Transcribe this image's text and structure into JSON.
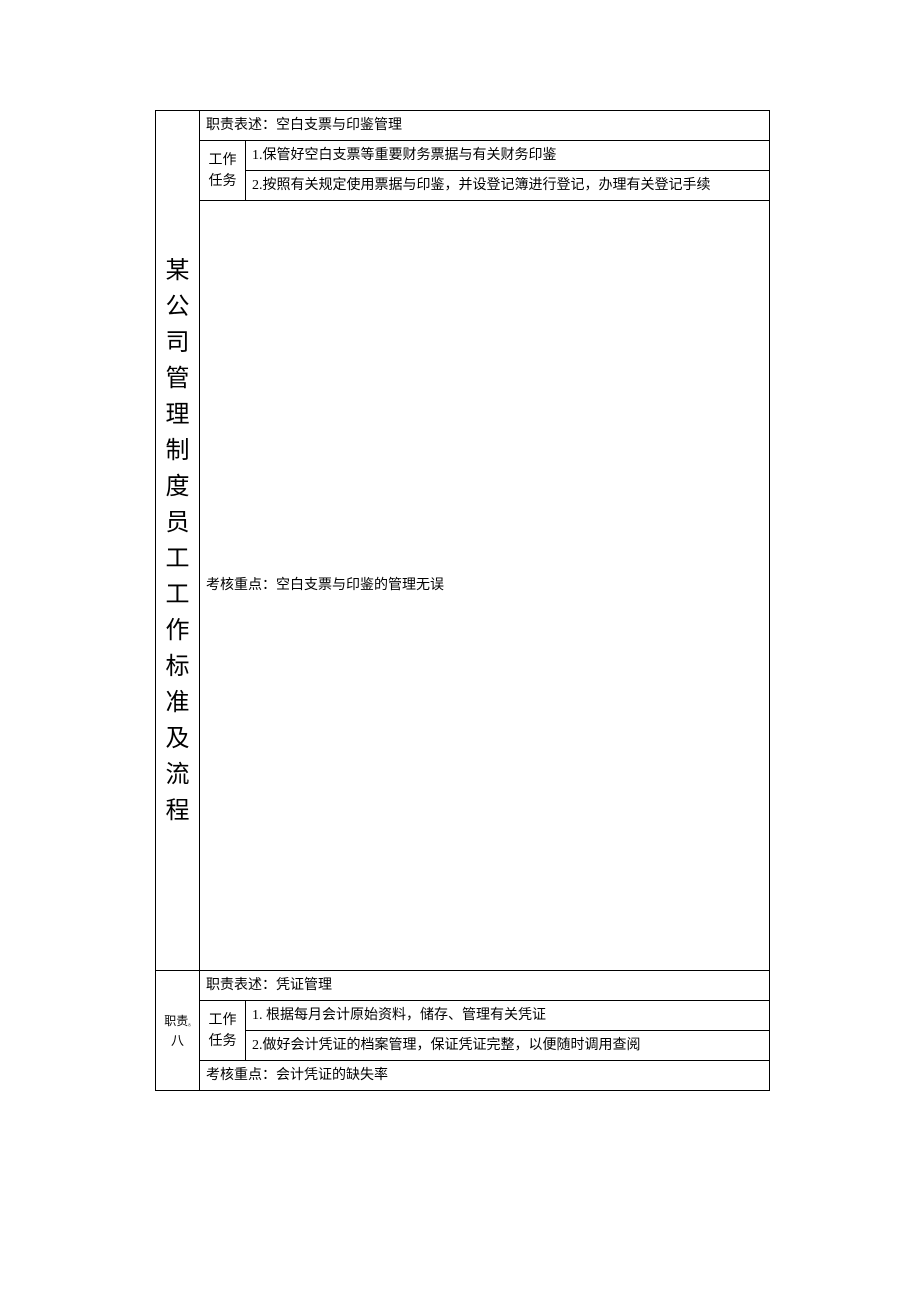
{
  "verticalTitle": "某公司管理制度员工工作标准及流程",
  "section1": {
    "dutyDescription": "职责表述：空白支票与印鉴管理",
    "taskLabel": "工作任务",
    "task1": "1.保管好空白支票等重要财务票据与有关财务印鉴",
    "task2": "2.按照有关规定使用票据与印鉴，并设登记簿进行登记，办理有关登记手续",
    "assessment": "考核重点：空白支票与印鉴的管理无误"
  },
  "section2": {
    "leftLabel": "职责八",
    "leftLabelSuffix": "八",
    "dutyDescription": "职责表述：凭证管理",
    "taskLabel": "工作任务",
    "task1": "1. 根据每月会计原始资料，储存、管理有关凭证",
    "task2": "2.做好会计凭证的档案管理，保证凭证完整，以便随时调用查阅",
    "assessment": "考核重点：会计凭证的缺失率"
  }
}
